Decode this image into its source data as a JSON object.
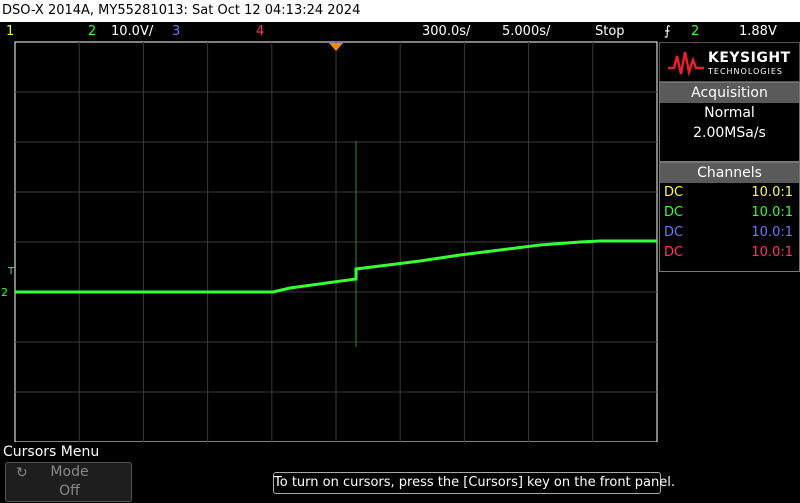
{
  "title_bar": "DSO-X 2014A, MY55281013: Sat Oct 12 04:13:24 2024",
  "status": {
    "ch1_label": "1",
    "ch2_label": "2",
    "ch2_scale": "10.0V/",
    "ch3_label": "3",
    "ch4_label": "4",
    "timebase": "300.0s/",
    "delay": "5.000s/",
    "run_state": "Stop",
    "trigger_icon": "trigger-edge-icon",
    "trigger_icon_glyph": "⨍",
    "trigger_channel": "2",
    "trigger_level": "1.88V"
  },
  "colors": {
    "ch1": "#ffff33",
    "ch2": "#33ff33",
    "ch3": "#6677ff",
    "ch4": "#ff3366",
    "trigger_marker": "#ff8800",
    "grid": "#3a3a3a"
  },
  "markers": {
    "trigger_level_marker": "T",
    "ch2_ground_marker": "2"
  },
  "logo": {
    "brand": "KEYSIGHT",
    "sub": "TECHNOLOGIES"
  },
  "acquisition": {
    "header": "Acquisition",
    "mode": "Normal",
    "rate": "2.00MSa/s"
  },
  "channels": {
    "header": "Channels",
    "rows": [
      {
        "coupling": "DC",
        "ratio": "10.0:1"
      },
      {
        "coupling": "DC",
        "ratio": "10.0:1"
      },
      {
        "coupling": "DC",
        "ratio": "10.0:1"
      },
      {
        "coupling": "DC",
        "ratio": "10.0:1"
      }
    ]
  },
  "menu": {
    "title": "Cursors Menu",
    "softkey_label": "Mode",
    "softkey_value": "Off",
    "hint": "To turn on cursors, press the [Cursors] key on the front panel."
  }
}
